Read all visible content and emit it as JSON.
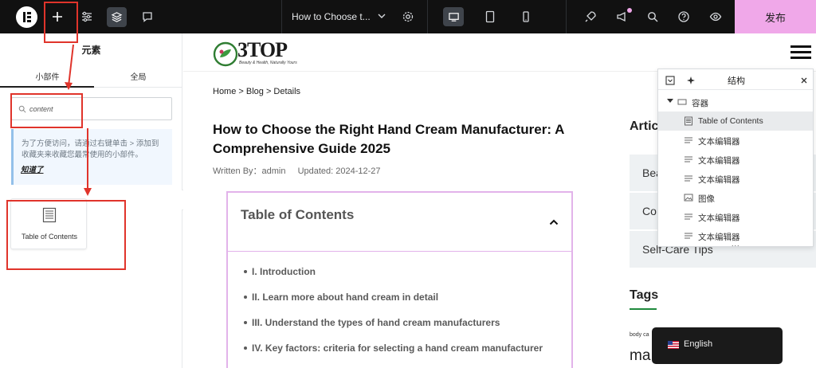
{
  "topbar": {
    "doc_title": "How to Choose t...",
    "publish_label": "发布"
  },
  "panel": {
    "title": "元素",
    "tabs": [
      "小部件",
      "全局"
    ],
    "search": {
      "value": "content"
    },
    "tip_text": "为了方便访问，请通过右键单击 > 添加到收藏夹来收藏您最常使用的小部件。",
    "tip_link": "知道了",
    "widget_label": "Table of Contents"
  },
  "site": {
    "brand_name": "3TOP",
    "brand_tagline": "Beauty & Health, Naturally Yours",
    "breadcrumb": "Home > Blog > Details",
    "post_title": "How to Choose the Right Hand Cream Manufacturer: A Comprehensive Guide 2025",
    "written_by": "Written By：admin",
    "updated": "Updated: 2024-12-27",
    "toc_title": "Table of Contents",
    "toc_items": [
      "I. Introduction",
      "II. Learn more about hand cream in detail",
      "III. Understand the types of hand cream manufacturers",
      "IV. Key factors: criteria for selecting a hand cream manufacturer"
    ],
    "sidebar_heading": "Artic",
    "categories": [
      "Bea",
      "Co",
      "Self-Care Tips"
    ],
    "tags_heading": "Tags",
    "tag_small": "body ca",
    "tag_big": "ma"
  },
  "structure": {
    "title": "结构",
    "items": [
      {
        "label": "容器",
        "icon": "container-icon"
      },
      {
        "label": "Table of Contents",
        "icon": "toc-icon"
      },
      {
        "label": "文本编辑器",
        "icon": "text-editor-icon"
      },
      {
        "label": "文本编辑器",
        "icon": "text-editor-icon"
      },
      {
        "label": "文本编辑器",
        "icon": "text-editor-icon"
      },
      {
        "label": "图像",
        "icon": "image-icon"
      },
      {
        "label": "文本编辑器",
        "icon": "text-editor-icon"
      },
      {
        "label": "文本编辑器",
        "icon": "text-editor-icon"
      }
    ],
    "more": "..."
  },
  "language": {
    "label": "English"
  },
  "colors": {
    "topbar": "#111111",
    "publish": "#f0a8e9",
    "annotation": "#e0342b",
    "toc_border": "#e2b3ea",
    "tip_bg": "#f1f7fe"
  }
}
